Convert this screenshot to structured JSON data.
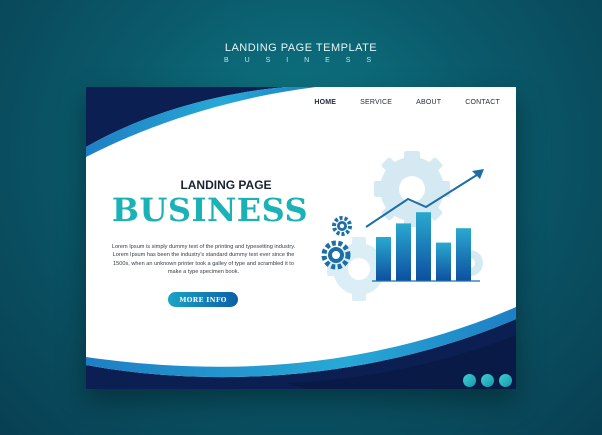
{
  "page": {
    "title": "LANDING PAGE TEMPLATE",
    "subtitle": "B U S I N E S S"
  },
  "nav": {
    "items": [
      {
        "label": "HOME",
        "active": true
      },
      {
        "label": "SERVICE",
        "active": false
      },
      {
        "label": "ABOUT",
        "active": false
      },
      {
        "label": "CONTACT",
        "active": false
      }
    ]
  },
  "hero": {
    "kicker": "LANDING PAGE",
    "title": "BUSINESS",
    "body": "Lorem Ipsum is simply dummy text of the printing and typesetting industry. Lorem Ipsum has been the industry's standard dummy text ever since the 1500s, when an unknown printer took a galley of type and scrambled it to make a type specimen book.",
    "button_label": "MORE INFO"
  },
  "illustration": {
    "icons": [
      "gear-icon",
      "bar-chart-icon",
      "trend-arrow-icon"
    ],
    "bar_levels": [
      0.55,
      0.72,
      0.86,
      0.48,
      0.66
    ]
  },
  "pagination": {
    "dot_count": 3
  },
  "colors": {
    "background": "#0a5a6b",
    "accent": "#1ab2b6",
    "navy": "#0c1f52",
    "blue": "#1e7fc4",
    "gear": "#d5e9f2"
  }
}
